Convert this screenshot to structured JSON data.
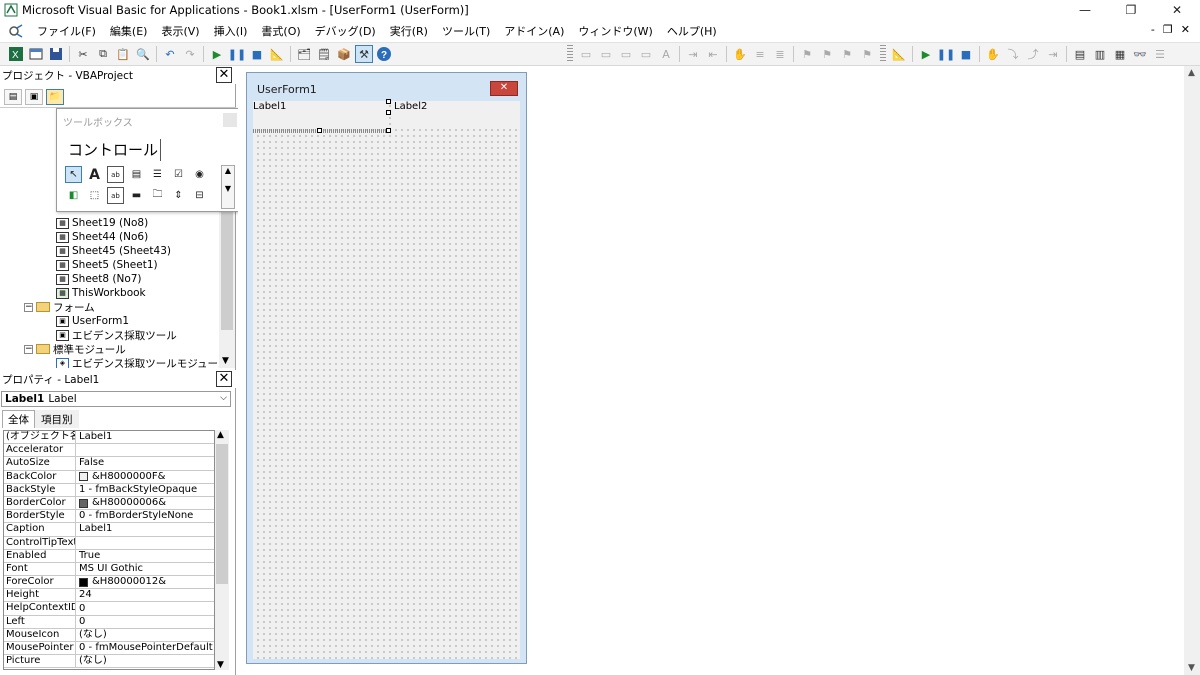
{
  "window": {
    "title": "Microsoft Visual Basic for Applications - Book1.xlsm - [UserForm1 (UserForm)]",
    "minimize": "—",
    "restore": "❐",
    "close": "✕"
  },
  "menu": {
    "items": [
      "ファイル(F)",
      "編集(E)",
      "表示(V)",
      "挿入(I)",
      "書式(O)",
      "デバッグ(D)",
      "実行(R)",
      "ツール(T)",
      "アドイン(A)",
      "ウィンドウ(W)",
      "ヘルプ(H)"
    ],
    "mdi_min": "-",
    "mdi_restore": "❐",
    "mdi_close": "✕"
  },
  "project": {
    "header": "プロジェクト - VBAProject",
    "close": "✕",
    "tree": {
      "sheet_partial": "Sheet19 (No8)",
      "sheet44": "Sheet44 (No6)",
      "sheet45": "Sheet45 (Sheet43)",
      "sheet5": "Sheet5 (Sheet1)",
      "sheet8": "Sheet8 (No7)",
      "thisworkbook": "ThisWorkbook",
      "forms_folder": "フォーム",
      "userform1": "UserForm1",
      "evidence_form": "エビデンス採取ツール",
      "modules_folder": "標準モジュール",
      "evidence_module": "エビデンス採取ツールモジュール"
    }
  },
  "toolbox": {
    "title": "ツールボックス",
    "tab": "コントロール"
  },
  "properties": {
    "header": "プロパティ - Label1",
    "close": "✕",
    "object_name": "Label1",
    "object_type": "Label",
    "tabs": [
      "全体",
      "項目別"
    ],
    "rows": [
      {
        "name": "(オブジェクト名)",
        "value": "Label1"
      },
      {
        "name": "Accelerator",
        "value": ""
      },
      {
        "name": "AutoSize",
        "value": "False"
      },
      {
        "name": "BackColor",
        "value": "&H8000000F&"
      },
      {
        "name": "BackStyle",
        "value": "1 - fmBackStyleOpaque"
      },
      {
        "name": "BorderColor",
        "value": "&H80000006&"
      },
      {
        "name": "BorderStyle",
        "value": "0 - fmBorderStyleNone"
      },
      {
        "name": "Caption",
        "value": "Label1"
      },
      {
        "name": "ControlTipText",
        "value": ""
      },
      {
        "name": "Enabled",
        "value": "True"
      },
      {
        "name": "Font",
        "value": "MS UI Gothic"
      },
      {
        "name": "ForeColor",
        "value": "&H80000012&"
      },
      {
        "name": "Height",
        "value": "24"
      },
      {
        "name": "HelpContextID",
        "value": "0"
      },
      {
        "name": "Left",
        "value": "0"
      },
      {
        "name": "MouseIcon",
        "value": "(なし)"
      },
      {
        "name": "MousePointer",
        "value": "0 - fmMousePointerDefault"
      },
      {
        "name": "Picture",
        "value": "(なし)"
      }
    ],
    "colors": {
      "backcolor_swatch": "#f0f0f0",
      "bordercolor_swatch": "#646464",
      "forecolor_swatch": "#000000"
    }
  },
  "designer": {
    "form_title": "UserForm1",
    "label1": "Label1",
    "label2": "Label2"
  }
}
